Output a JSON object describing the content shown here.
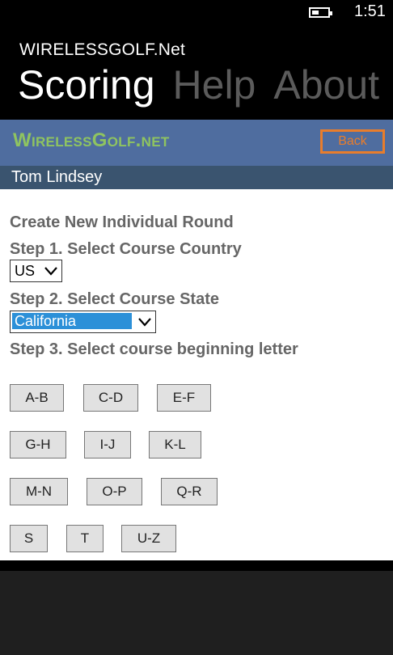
{
  "status_bar": {
    "time": "1:51",
    "battery_level": 0.45
  },
  "app": {
    "title": "WIRELESSGOLF.Net"
  },
  "pivot": {
    "tabs": [
      "Scoring",
      "Help",
      "About"
    ],
    "active": "Scoring"
  },
  "banner": {
    "brand": "WirelessGolf.net",
    "back_label": "Back",
    "colors": {
      "banner": "#4f6d9f",
      "brand": "#8fc460",
      "back": "#e87d2c"
    }
  },
  "user": {
    "name": "Tom Lindsey"
  },
  "form": {
    "heading": "Create New Individual Round",
    "step1_label": "Step 1. Select Course Country",
    "country_value": "US",
    "step2_label": "Step 2. Select Course State",
    "state_value": "California",
    "step3_label": "Step 3. Select course beginning letter"
  },
  "letter_buttons": [
    "A-B",
    "C-D",
    "E-F",
    "G-H",
    "I-J",
    "K-L",
    "M-N",
    "O-P",
    "Q-R",
    "S",
    "T",
    "U-Z"
  ]
}
